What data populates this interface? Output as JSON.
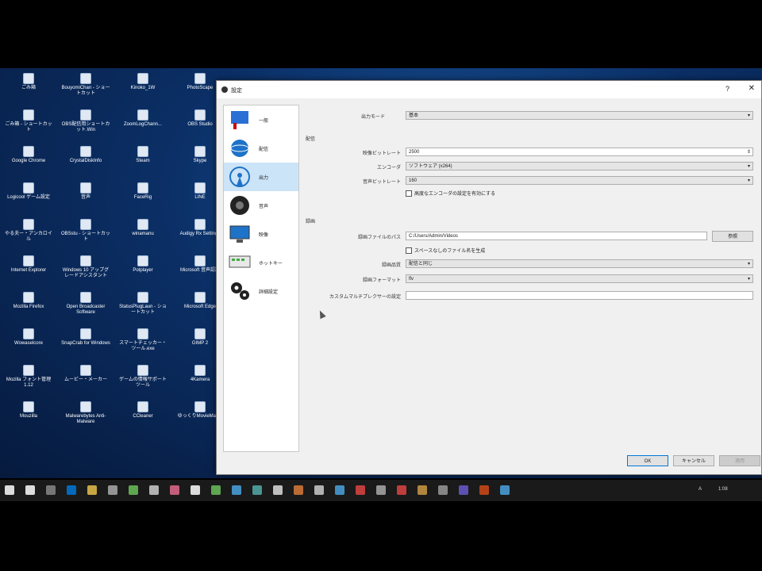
{
  "desktop_icons": [
    {
      "label": "ごみ箱",
      "x": 0,
      "y": 0
    },
    {
      "label": "BouyomiChan - ショートカット",
      "x": 0,
      "y": 0
    },
    {
      "label": "Kinoko_1W",
      "x": 0,
      "y": 0
    },
    {
      "label": "PhotoScape",
      "x": 0,
      "y": 0
    },
    {
      "label": "ごみ箱 - ショートカット",
      "x": 0,
      "y": 0
    },
    {
      "label": "OBS配信用ショートカット.Win",
      "x": 0,
      "y": 0
    },
    {
      "label": "ZoomLogChann...",
      "x": 0,
      "y": 0
    },
    {
      "label": "OBS Studio",
      "x": 0,
      "y": 0
    },
    {
      "label": "Google Chrome",
      "x": 0,
      "y": 0
    },
    {
      "label": "CrystalDiskInfo",
      "x": 0,
      "y": 0
    },
    {
      "label": "Steam",
      "x": 0,
      "y": 0
    },
    {
      "label": "Skype",
      "x": 0,
      "y": 0
    },
    {
      "label": "Logicool ゲーム設定",
      "x": 0,
      "y": 0
    },
    {
      "label": "音声",
      "x": 0,
      "y": 0
    },
    {
      "label": "FaceRig",
      "x": 0,
      "y": 0
    },
    {
      "label": "LINE",
      "x": 0,
      "y": 0
    },
    {
      "label": "やる夫ー・アンカロイル",
      "x": 0,
      "y": 0
    },
    {
      "label": "OBSstu - ショートカット",
      "x": 0,
      "y": 0
    },
    {
      "label": "winamanu",
      "x": 0,
      "y": 0
    },
    {
      "label": "Audigy Rx Settings",
      "x": 0,
      "y": 0
    },
    {
      "label": "Internet Explorer",
      "x": 0,
      "y": 0
    },
    {
      "label": "Windows 10 アップグレードアシスタント",
      "x": 0,
      "y": 0
    },
    {
      "label": "Potplayer",
      "x": 0,
      "y": 0
    },
    {
      "label": "Microsoft 音声認識",
      "x": 0,
      "y": 0
    },
    {
      "label": "Mozilla Firefox",
      "x": 0,
      "y": 0
    },
    {
      "label": "Open Broadcaster Software",
      "x": 0,
      "y": 0
    },
    {
      "label": "StatusPlugLaun - ショートカット",
      "x": 0,
      "y": 0
    },
    {
      "label": "Microsoft Edge",
      "x": 0,
      "y": 0
    },
    {
      "label": "Wowaselcore",
      "x": 0,
      "y": 0
    },
    {
      "label": "SnapCrab for Windows",
      "x": 0,
      "y": 0
    },
    {
      "label": "スマートチェッカー・ツール.exe",
      "x": 0,
      "y": 0
    },
    {
      "label": "GIMP 2",
      "x": 0,
      "y": 0
    },
    {
      "label": "Mozilla フォント管理 1.12",
      "x": 0,
      "y": 0
    },
    {
      "label": "ムービー・メーカー",
      "x": 0,
      "y": 0
    },
    {
      "label": "ゲームの情報サポートツール",
      "x": 0,
      "y": 0
    },
    {
      "label": "4Kamera",
      "x": 0,
      "y": 0
    },
    {
      "label": "Mouzilla",
      "x": 0,
      "y": 0
    },
    {
      "label": "Malwarebytes Anti-Malware",
      "x": 0,
      "y": 0
    },
    {
      "label": "CCleaner",
      "x": 0,
      "y": 0
    },
    {
      "label": "ゆっくりMovieMaker",
      "x": 0,
      "y": 0
    }
  ],
  "dialog": {
    "title": "設定",
    "help_glyph": "?",
    "close_glyph": "✕",
    "nav": [
      {
        "label": "一般",
        "icon": "general-icon",
        "active": false
      },
      {
        "label": "配信",
        "icon": "stream-icon",
        "active": false
      },
      {
        "label": "出力",
        "icon": "output-icon",
        "active": true
      },
      {
        "label": "音声",
        "icon": "audio-icon",
        "active": false
      },
      {
        "label": "映像",
        "icon": "video-icon",
        "active": false
      },
      {
        "label": "ホットキー",
        "icon": "hotkey-icon",
        "active": false
      },
      {
        "label": "詳細設定",
        "icon": "advanced-icon",
        "active": false
      }
    ],
    "output_mode_label": "出力モード",
    "output_mode_value": "基本",
    "streaming": {
      "section": "配信",
      "video_bitrate_label": "映像ビットレート",
      "video_bitrate_value": "2500",
      "encoder_label": "エンコーダ",
      "encoder_value": "ソフトウェア (x264)",
      "audio_bitrate_label": "音声ビットレート",
      "audio_bitrate_value": "160",
      "advanced_encoder_check": "高度なエンコーダの設定を有効にする"
    },
    "recording": {
      "section": "録画",
      "path_label": "録画ファイルのパス",
      "path_value": "C:/Users/Admin/Videos",
      "browse_label": "参照",
      "no_space_check": "スペースなしのファイル名を生成",
      "quality_label": "録画品質",
      "quality_value": "配信と同じ",
      "format_label": "録画フォーマット",
      "format_value": "flv",
      "muxer_label": "カスタムマルチプレクサーの設定",
      "muxer_value": ""
    },
    "buttons": {
      "ok": "OK",
      "cancel": "キャンセル",
      "apply": "適用"
    }
  },
  "taskbar": {
    "time": "1:08",
    "ime": "A",
    "accent": "#0078d7"
  }
}
